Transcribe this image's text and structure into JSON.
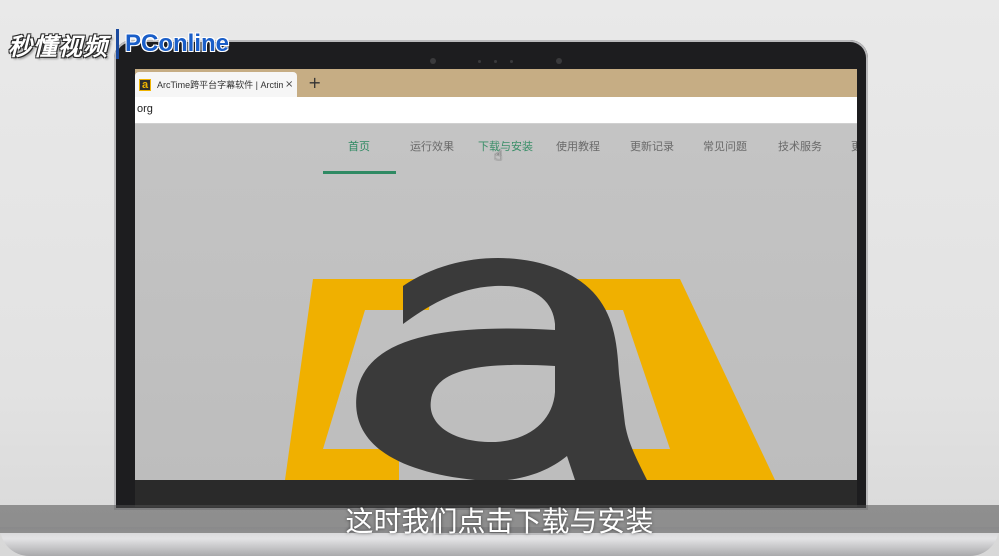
{
  "watermark": {
    "brand": "秒懂视频",
    "partner": "PConline"
  },
  "browser": {
    "tab_title": "ArcTime跨平台字幕软件 | Arctim",
    "tab_close": "×",
    "new_tab": "+",
    "favicon": "a",
    "url": "org"
  },
  "site_nav": {
    "items": [
      {
        "label": "首页",
        "state": "active"
      },
      {
        "label": "运行效果"
      },
      {
        "label": "下载与安装",
        "state": "hover"
      },
      {
        "label": "使用教程"
      },
      {
        "label": "更新记录"
      },
      {
        "label": "常见问题"
      },
      {
        "label": "技术服务"
      },
      {
        "label": "更"
      }
    ],
    "accent_color": "#2f8a63"
  },
  "hero": {
    "logo_letter": "a",
    "bracket_color": "#f0b000",
    "letter_color": "#3a3a3a"
  },
  "cursor_icon": "hand-pointer-icon",
  "subtitle": "这时我们点击下载与安装"
}
